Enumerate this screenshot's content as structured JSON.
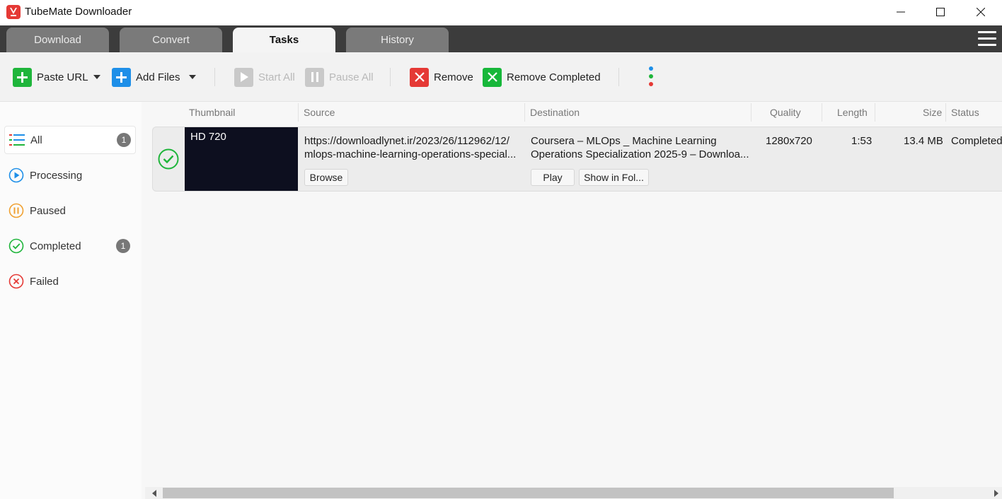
{
  "app": {
    "title": "TubeMate Downloader"
  },
  "tabs": [
    {
      "label": "Download"
    },
    {
      "label": "Convert"
    },
    {
      "label": "Tasks",
      "active": true
    },
    {
      "label": "History"
    }
  ],
  "toolbar": {
    "paste_url": "Paste URL",
    "add_files": "Add Files",
    "start_all": "Start All",
    "pause_all": "Pause All",
    "remove": "Remove",
    "remove_completed": "Remove Completed"
  },
  "sidebar": {
    "items": [
      {
        "label": "All",
        "count": "1",
        "active": true,
        "icon": "list-icon"
      },
      {
        "label": "Processing",
        "icon": "play-circle-icon"
      },
      {
        "label": "Paused",
        "icon": "pause-circle-icon"
      },
      {
        "label": "Completed",
        "count": "1",
        "icon": "check-circle-icon"
      },
      {
        "label": "Failed",
        "icon": "x-circle-icon"
      }
    ]
  },
  "table": {
    "columns": [
      "Thumbnail",
      "Source",
      "Destination",
      "Quality",
      "Length",
      "Size",
      "Status"
    ],
    "rows": [
      {
        "thumbnail_label": "HD 720",
        "source_line1": "https://downloadlynet.ir/2023/26/112962/12/",
        "source_line2": "mlops-machine-learning-operations-special...",
        "destination_line1": "Coursera – MLOps _ Machine Learning",
        "destination_line2": "Operations Specialization 2025-9 – Downloa...",
        "quality": "1280x720",
        "length": "1:53",
        "size": "13.4 MB",
        "status": "Completed",
        "browse_label": "Browse",
        "play_label": "Play",
        "show_in_folder_label": "Show in Fol..."
      }
    ]
  },
  "colors": {
    "tab_bar": "#3c3c3c",
    "accent_green": "#1fb53b",
    "accent_blue": "#1e8fe8",
    "accent_red": "#e53935"
  }
}
